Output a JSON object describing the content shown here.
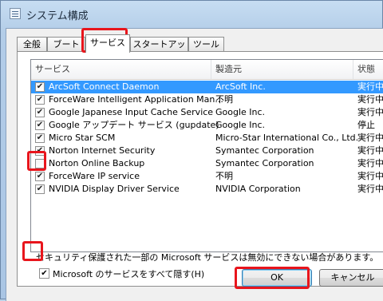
{
  "window": {
    "title": "システム構成"
  },
  "tabs": [
    "全般",
    "ブート",
    "サービス",
    "スタートアップ",
    "ツール"
  ],
  "active_tab": "サービス",
  "services": {
    "columns": [
      "サービス",
      "製造元",
      "状態"
    ],
    "rows": [
      {
        "checked": true,
        "name": "ArcSoft Connect Daemon",
        "maker": "ArcSoft Inc.",
        "status": "実行中",
        "selected": true
      },
      {
        "checked": true,
        "name": "ForceWare Intelligent Application Man...",
        "maker": "不明",
        "status": "実行中"
      },
      {
        "checked": true,
        "name": "Google Japanese Input Cache Service",
        "maker": "Google Inc.",
        "status": "実行中"
      },
      {
        "checked": true,
        "name": "Google アップデート サービス (gupdate)",
        "maker": "Google Inc.",
        "status": "停止"
      },
      {
        "checked": true,
        "name": "Micro Star SCM",
        "maker": "Micro-Star International Co., Ltd.",
        "status": "実行中"
      },
      {
        "checked": true,
        "name": "Norton Internet Security",
        "maker": "Symantec Corporation",
        "status": "実行中"
      },
      {
        "checked": false,
        "name": "Norton Online Backup",
        "maker": "Symantec Corporation",
        "status": "実行中"
      },
      {
        "checked": true,
        "name": "ForceWare IP service",
        "maker": "不明",
        "status": "実行中"
      },
      {
        "checked": true,
        "name": "NVIDIA Display Driver Service",
        "maker": "NVIDIA Corporation",
        "status": "実行中"
      }
    ]
  },
  "note": "セキュリティ保護された一部の Microsoft サービスは無効にできない場合があります。",
  "hide_ms": {
    "checked": true,
    "label": "Microsoft のサービスをすべて隠す(H)"
  },
  "buttons": {
    "ok": "OK",
    "cancel": "キャンセル"
  },
  "colors": {
    "highlight": "#e8151c",
    "selection": "#3399ff"
  }
}
